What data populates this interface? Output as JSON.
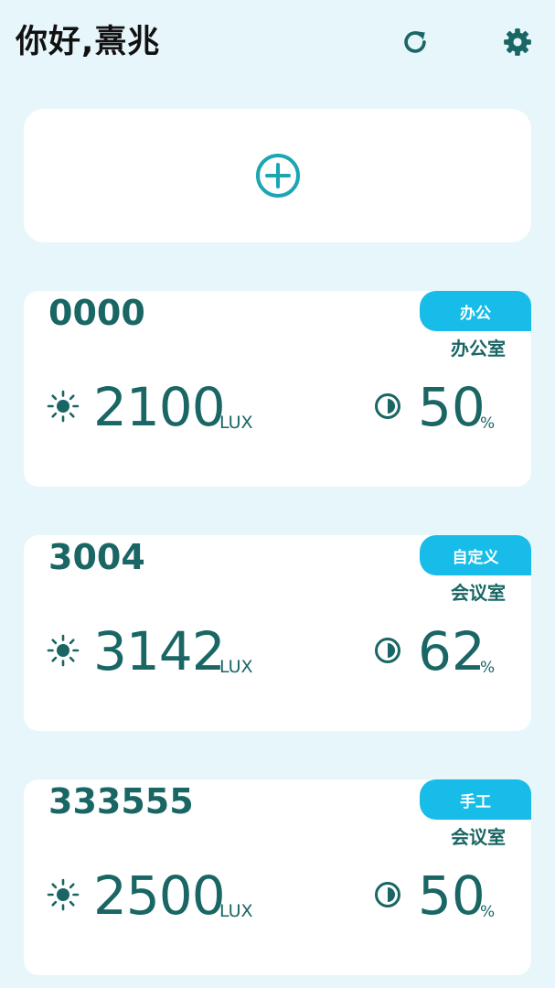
{
  "header": {
    "greeting": "你好,熹兆",
    "refresh_icon": "refresh-icon",
    "settings_icon": "gear-icon"
  },
  "add_card": {
    "icon": "add-circle-icon"
  },
  "colors": {
    "background": "#e6f6fb",
    "card": "#ffffff",
    "text_primary": "#196664",
    "accent": "#17bde8"
  },
  "devices": [
    {
      "id": "0000",
      "mode": "办公",
      "room": "办公室",
      "lux": "2100",
      "lux_unit": "LUX",
      "percent": "50",
      "percent_unit": "%"
    },
    {
      "id": "3004",
      "mode": "自定义",
      "room": "会议室",
      "lux": "3142",
      "lux_unit": "LUX",
      "percent": "62",
      "percent_unit": "%"
    },
    {
      "id": "333555",
      "mode": "手工",
      "room": "会议室",
      "lux": "2500",
      "lux_unit": "LUX",
      "percent": "50",
      "percent_unit": "%"
    }
  ]
}
